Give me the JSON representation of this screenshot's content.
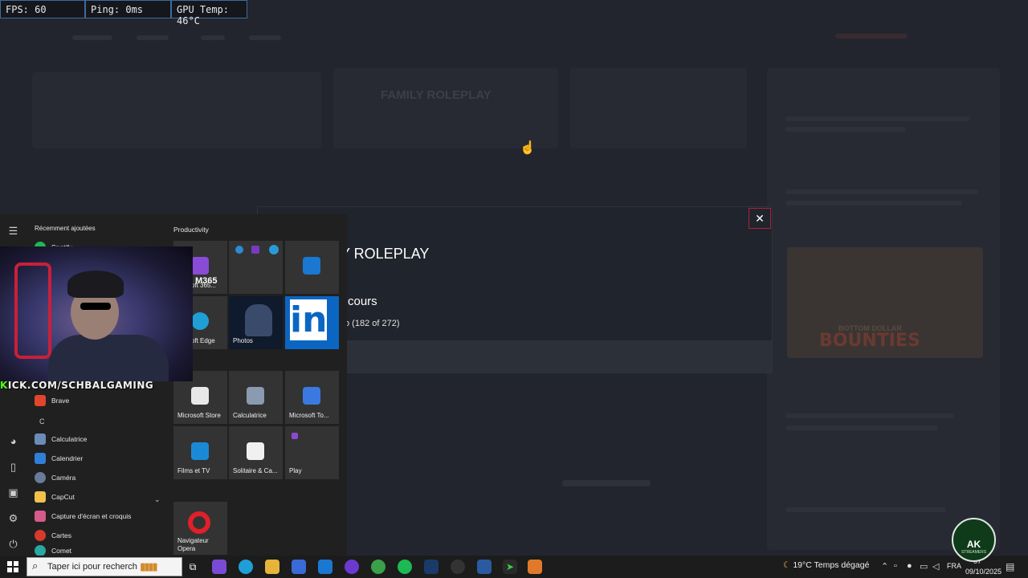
{
  "overlay": {
    "fps": "FPS: 60",
    "ping": "Ping: 0ms",
    "gpu_temp": "GPU Temp: 46°C"
  },
  "background": {
    "server_name": "FAMILY ROLEPLAY",
    "poster_title": "BOUNTIES",
    "poster_subtitle": "BOTTOM DOLLAR"
  },
  "modal": {
    "close_glyph": "✕",
    "title": "Y ROLEPLAY",
    "status": "cours",
    "progress": "o (182 of 272)"
  },
  "start_menu": {
    "recent_header": "Récemment ajoutées",
    "tiles_header": "Productivity",
    "apps": {
      "spotify": "Spotify",
      "brave": "Brave",
      "letter_c": "C",
      "calculatrice": "Calculatrice",
      "calendrier": "Calendrier",
      "camera": "Caméra",
      "capcut": "CapCut",
      "capture": "Capture d'écran et croquis",
      "cartes": "Cartes",
      "comet": "Comet"
    },
    "tiles": {
      "m365_label": "M365",
      "m365": "icrosoft 365...",
      "edge": "icrosoft Edge",
      "photos": "Photos",
      "linkedin": "in",
      "store": "Microsoft Store",
      "calculatrice": "Calculatrice",
      "todo": "Microsoft To...",
      "films": "Films et TV",
      "solitaire": "Solitaire & Ca...",
      "play": "Play",
      "opera": "Navigateur Opera"
    }
  },
  "webcam": {
    "channel_prefix": "K",
    "channel_rest": "ICK.COM/SCHBALGAMING"
  },
  "logo": {
    "text": "AK",
    "sub": "STREAMERS"
  },
  "taskbar": {
    "search_placeholder": "Taper ici pour recherche",
    "weather": "19°C  Temps dégagé",
    "language": "FRA",
    "time": "07",
    "date": "09/10/2025"
  },
  "colors": {
    "overlay_border": "#3d6b9c",
    "close_border": "#b0203a",
    "linkedin": "#0a66c2",
    "kick_green": "#53fc18"
  }
}
